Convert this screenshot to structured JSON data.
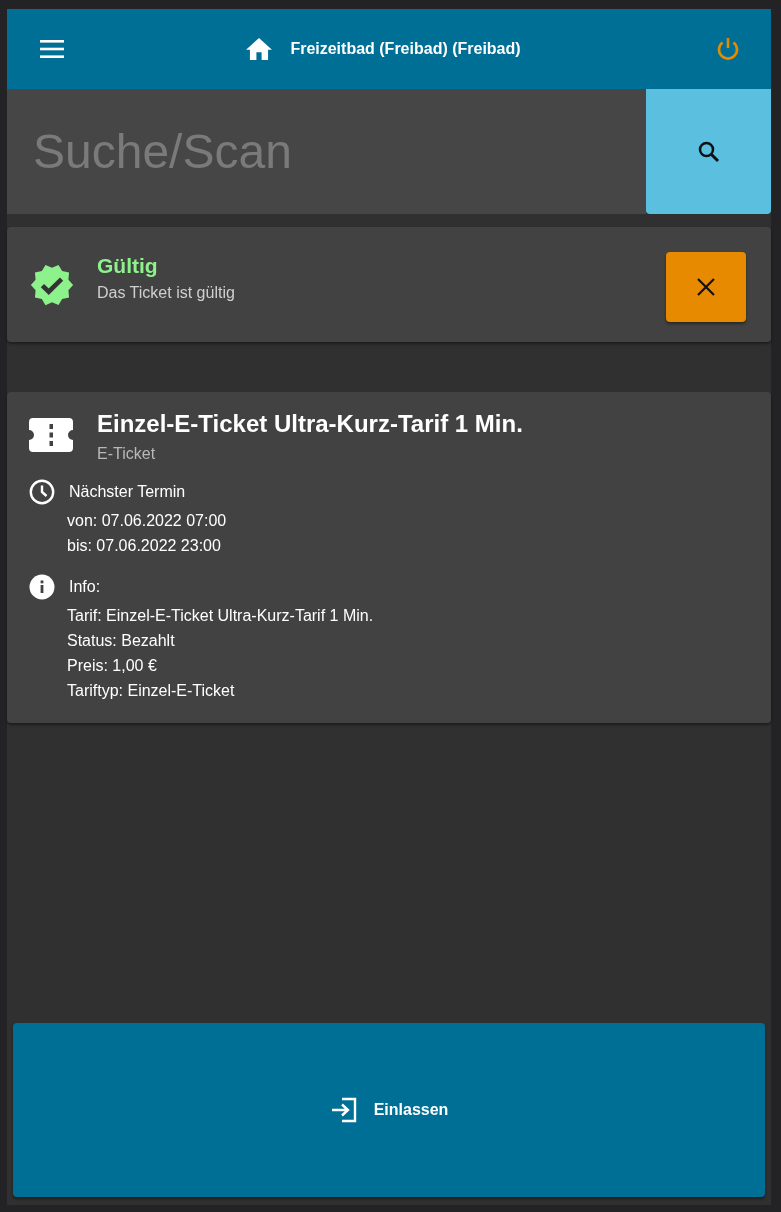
{
  "header": {
    "title": "Freizeitbad (Freibad) (Freibad)"
  },
  "search": {
    "placeholder": "Suche/Scan"
  },
  "status": {
    "kind": "valid",
    "title": "Gültig",
    "message": "Das Ticket ist gültig"
  },
  "ticket": {
    "title": "Einzel-E-Ticket Ultra-Kurz-Tarif 1 Min.",
    "subtitle": "E-Ticket",
    "sections": [
      {
        "kind": "schedule",
        "heading": "Nächster Termin",
        "lines": [
          "von: 07.06.2022 07:00",
          "bis: 07.06.2022 23:00"
        ]
      },
      {
        "kind": "info",
        "heading": "Info:",
        "lines": [
          "Tarif: Einzel-E-Ticket Ultra-Kurz-Tarif 1 Min.",
          "Status: Bezahlt",
          "Preis: 1,00 €",
          "Tariftyp: Einzel-E-Ticket"
        ]
      }
    ]
  },
  "action": {
    "label": "Einlassen"
  }
}
